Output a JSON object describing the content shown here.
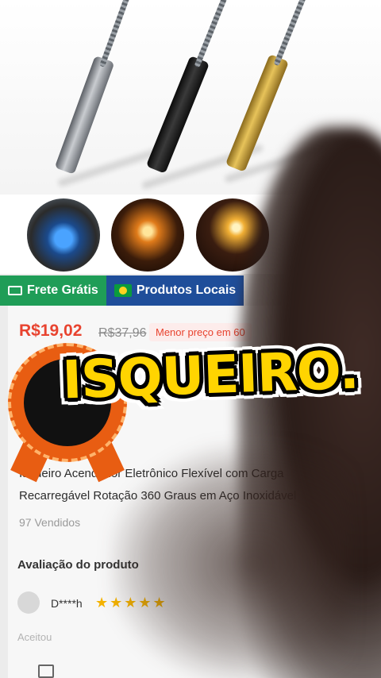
{
  "product": {
    "price": "R$19,02",
    "old_price": "R$37,96",
    "low_price_tag": "Menor preço em 60",
    "title_line1": "Isqueiro Acendedor Eletrônico Flexível com Carga",
    "title_line2": "Recarregável Rotação 360 Graus em Aço Inoxidável",
    "sold": "97 Vendidos"
  },
  "badges": {
    "free_shipping": "Frete Grátis",
    "local_products": "Produtos Locais"
  },
  "reviews": {
    "heading": "Avaliação do produto",
    "reviewer": "D****h",
    "stars": "★★★★★",
    "meta": "Aceitou"
  },
  "caption": "ISQUEIRO.",
  "colors": {
    "price_red": "#e8432f",
    "badge_green": "#1f9d57",
    "badge_blue": "#1f4e9a",
    "caption_yellow": "#ffd400"
  },
  "icons": [
    "truck-icon",
    "brazil-flag-icon",
    "bag-icon"
  ]
}
